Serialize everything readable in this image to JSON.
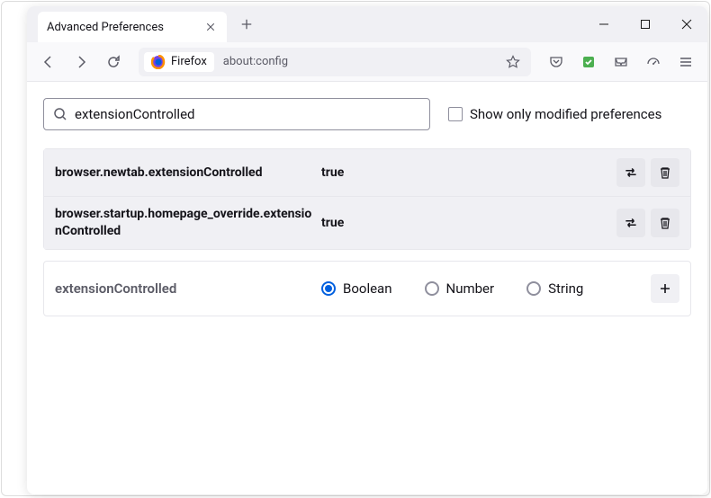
{
  "tab": {
    "title": "Advanced Preferences"
  },
  "urlbar": {
    "identity_label": "Firefox",
    "url": "about:config"
  },
  "search": {
    "value": "extensionControlled",
    "show_modified_label": "Show only modified preferences"
  },
  "prefs": [
    {
      "name": "browser.newtab.extensionControlled",
      "value": "true"
    },
    {
      "name": "browser.startup.homepage_override.extensionControlled",
      "value": "true"
    }
  ],
  "add": {
    "name": "extensionControlled",
    "types": {
      "boolean": "Boolean",
      "number": "Number",
      "string": "String"
    }
  }
}
